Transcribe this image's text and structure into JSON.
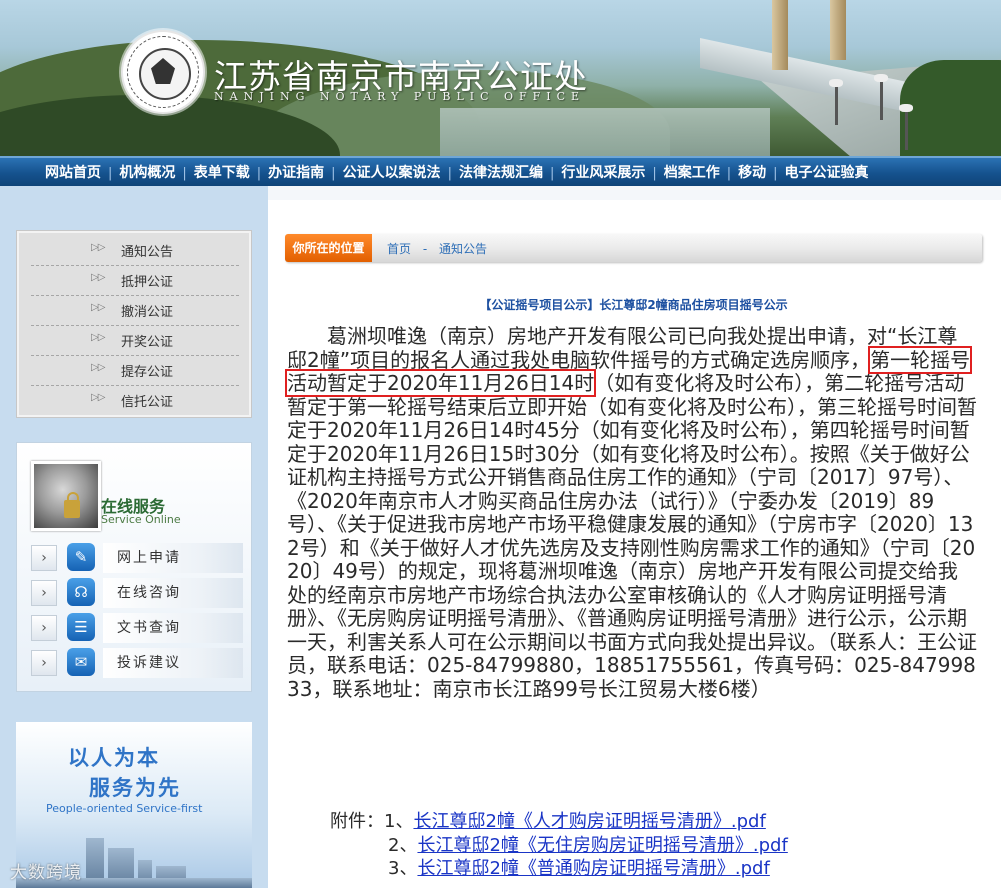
{
  "header": {
    "title": "江苏省南京市南京公证处",
    "subtitle": "NANJING NOTARY PUBLIC OFFICE"
  },
  "nav": {
    "items": [
      "网站首页",
      "机构概况",
      "表单下载",
      "办证指南",
      "公证人以案说法",
      "法律法规汇编",
      "行业风采展示",
      "档案工作",
      "移动",
      "电子公证验真"
    ]
  },
  "sidebar": {
    "menu": [
      {
        "label": "通知公告",
        "icon": "double-chevron-right-icon"
      },
      {
        "label": "抵押公证",
        "icon": "double-chevron-right-icon"
      },
      {
        "label": "撤消公证",
        "icon": "double-chevron-right-icon"
      },
      {
        "label": "开奖公证",
        "icon": "double-chevron-right-icon"
      },
      {
        "label": "提存公证",
        "icon": "double-chevron-right-icon"
      },
      {
        "label": "信托公证",
        "icon": "double-chevron-right-icon"
      }
    ],
    "service": {
      "title": "在线服务",
      "subtitle": "Service Online",
      "items": [
        {
          "label": "网上申请",
          "icon": "edit-form-icon"
        },
        {
          "label": "在线咨询",
          "icon": "headset-icon"
        },
        {
          "label": "文书查询",
          "icon": "list-icon"
        },
        {
          "label": "投诉建议",
          "icon": "chat-bubble-icon"
        }
      ]
    },
    "promo": {
      "line1": "以人为本",
      "line2": "服务为先",
      "english": "People-oriented  Service-first"
    }
  },
  "breadcrumb": {
    "tag": "你所在的位置",
    "home": "首页",
    "separator": "-",
    "current": "通知公告"
  },
  "article": {
    "title": "【公证摇号项目公示】长江尊邸2幢商品住房项目摇号公示",
    "body_pre": "葛洲坝唯逸（南京）房地产开发有限公司已向我处提出申请，对“长江尊邸2幢”项目的报名人通过我处电脑软件摇号的方式确定选房顺序，",
    "body_highlight": "第一轮摇号活动暂定于2020年11月26日14时",
    "body_post": "（如有变化将及时公布），第二轮摇号活动暂定于第一轮摇号结束后立即开始（如有变化将及时公布），第三轮摇号时间暂定于2020年11月26日14时45分（如有变化将及时公布），第四轮摇号时间暂定于2020年11月26日15时30分（如有变化将及时公布）。按照《关于做好公证机构主持摇号方式公开销售商品住房工作的通知》（宁司〔2017〕97号）、《2020年南京市人才购买商品住房办法（试行）》（宁委办发〔2019〕89号）、《关于促进我市房地产市场平稳健康发展的通知》（宁房市字〔2020〕132号）和《关于做好人才优先选房及支持刚性购房需求工作的通知》（宁司〔2020〕49号）的规定，现将葛洲坝唯逸（南京）房地产开发有限公司提交给我处的经南京市房地产市场综合执法办公室审核确认的《人才购房证明摇号清册》、《无房购房证明摇号清册》、《普通购房证明摇号清册》进行公示，公示期一天，利害关系人可在公示期间以书面方式向我处提出异议。（联系人：王公证员，联系电话：025-84799880，18851755561，传真号码：025-84799833，联系地址：南京市长江路99号长江贸易大楼6楼）",
    "attachments_label": "附件：",
    "attachments": [
      {
        "num": "1、",
        "text": "长江尊邸2幢《人才购房证明摇号清册》.pdf"
      },
      {
        "num": "2、",
        "text": "长江尊邸2幢《无住房购房证明摇号清册》.pdf"
      },
      {
        "num": "3、",
        "text": "长江尊邸2幢《普通购房证明摇号清册》.pdf"
      }
    ]
  },
  "watermark": "大数跨境",
  "colors": {
    "nav": "#15528e",
    "accent_orange": "#e25f00",
    "link": "#1a35c6",
    "highlight_box": "#e02020",
    "title_blue": "#1c4fa0"
  }
}
